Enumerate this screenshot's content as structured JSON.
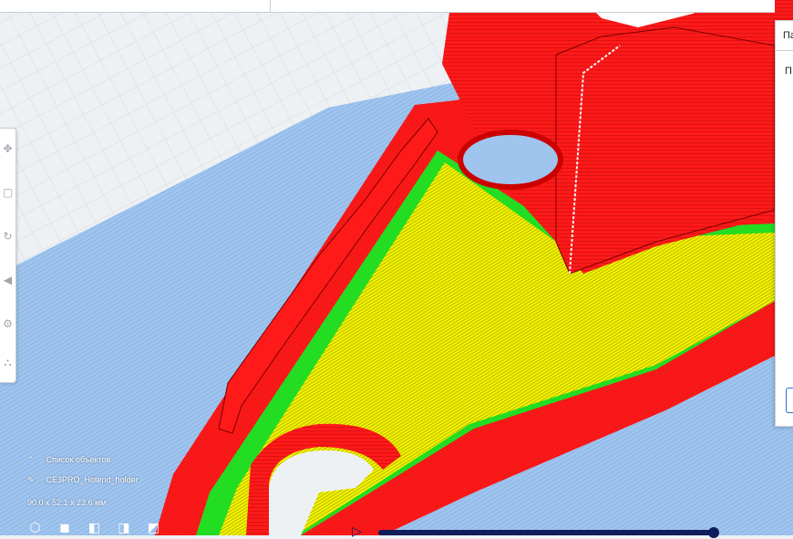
{
  "colors": {
    "wall_red": "#ff1a1a",
    "infill_yellow": "#f2f200",
    "inner_wall_green": "#22dd22",
    "plate_blue": "#9fc4ee",
    "background": "#eef1f4",
    "ui_accent": "#2a6fd6",
    "slider_navy": "#0f1e5a"
  },
  "panel": {
    "header": "Па",
    "row_label": "П"
  },
  "object_list": {
    "toggle_label": "Список объектов",
    "object_name": "CE3PRO_Hotend_holder",
    "dimensions": "90.0 x 52.1 x 23.6 мм"
  },
  "icons": {
    "collapse": "chevron-up-icon",
    "edit": "pencil-icon",
    "views": [
      "3d-view-icon",
      "front-view-icon",
      "top-view-icon",
      "left-view-icon",
      "right-view-icon"
    ],
    "tools": [
      "move-icon",
      "scale-icon",
      "rotate-icon",
      "mirror-icon",
      "per-model-settings-icon",
      "support-blocker-icon"
    ],
    "play": "play-icon"
  },
  "layer_slider": {
    "progress": 0.98
  }
}
